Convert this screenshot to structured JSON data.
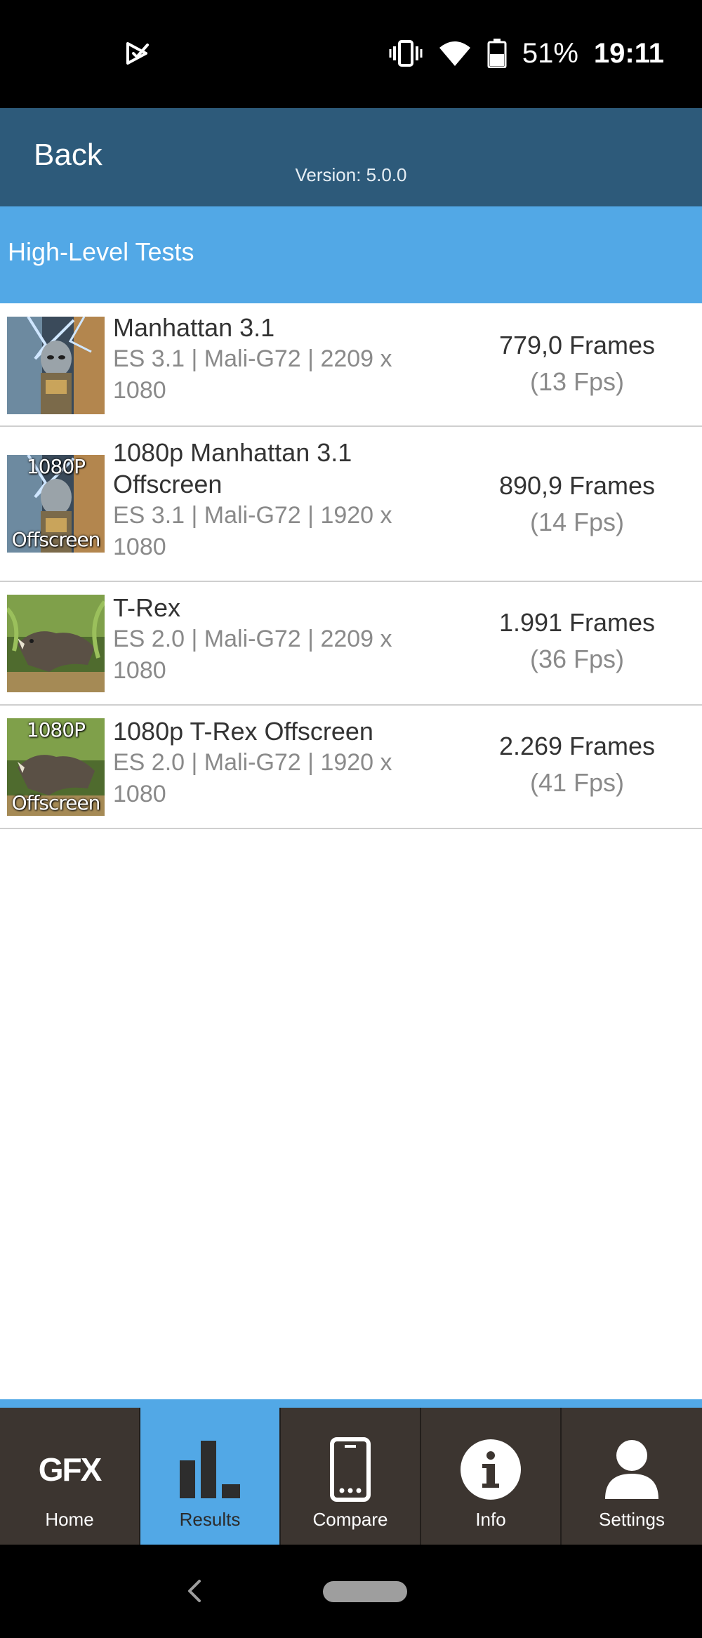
{
  "status_bar": {
    "left_icon": "play-check-icon",
    "icons": [
      "vibrate-icon",
      "wifi-icon",
      "battery-icon"
    ],
    "battery": "51%",
    "time": "19:11"
  },
  "header": {
    "back_label": "Back",
    "version": "Version: 5.0.0"
  },
  "section": {
    "title": "High-Level Tests"
  },
  "tests": [
    {
      "name": "Manhattan 3.1",
      "details": "ES 3.1 | Mali-G72 | 2209 x 1080",
      "frames": "779,0 Frames",
      "fps": "(13 Fps)",
      "thumb": "manhattan",
      "thumb_overlay_top": "",
      "thumb_overlay_bottom": ""
    },
    {
      "name": "1080p Manhattan 3.1 Offscreen",
      "details": "ES 3.1 | Mali-G72 | 1920 x 1080",
      "frames": "890,9 Frames",
      "fps": "(14 Fps)",
      "thumb": "manhattan",
      "thumb_overlay_top": "1080P",
      "thumb_overlay_bottom": "Offscreen"
    },
    {
      "name": "T-Rex",
      "details": "ES 2.0 | Mali-G72 | 2209 x 1080",
      "frames": "1.991 Frames",
      "fps": "(36 Fps)",
      "thumb": "trex",
      "thumb_overlay_top": "",
      "thumb_overlay_bottom": ""
    },
    {
      "name": "1080p T-Rex Offscreen",
      "details": "ES 2.0 | Mali-G72 | 1920 x 1080",
      "frames": "2.269 Frames",
      "fps": "(41 Fps)",
      "thumb": "trex",
      "thumb_overlay_top": "1080P",
      "thumb_overlay_bottom": "Offscreen"
    }
  ],
  "bottom_nav": {
    "active": "Results",
    "items": [
      {
        "label": "Home",
        "icon": "gfx-logo-icon",
        "icon_text": "GFX"
      },
      {
        "label": "Results",
        "icon": "bar-chart-icon"
      },
      {
        "label": "Compare",
        "icon": "phone-icon"
      },
      {
        "label": "Info",
        "icon": "info-icon"
      },
      {
        "label": "Settings",
        "icon": "user-icon"
      }
    ]
  },
  "system_nav": {
    "buttons": [
      "back-chevron-icon",
      "home-pill-icon"
    ]
  },
  "colors": {
    "status_bar": "#000000",
    "top_bar": "#2d5a7a",
    "section_header": "#52a8e6",
    "nav_background": "#3c3530",
    "nav_active": "#52a8e6",
    "test_name": "#333333",
    "test_details": "#8a8a8a"
  }
}
